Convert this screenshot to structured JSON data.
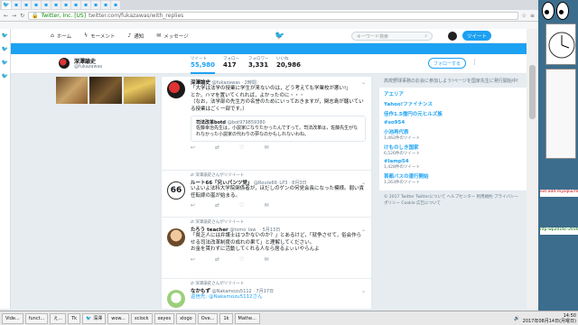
{
  "browser": {
    "tab_icon": "twitter-bird-icon",
    "url_company": "Twitter, Inc. [US]",
    "url": "twitter.com/fukazawas/with_replies"
  },
  "twitter_nav": {
    "home": "ホーム",
    "moments": "モーメント",
    "notifications": "通知",
    "messages": "メッセージ",
    "search_placeholder": "キーワード検索",
    "tweet_button": "ツイート"
  },
  "profile": {
    "name": "深澤諭史",
    "handle": "@fukazawas",
    "stats": [
      {
        "label": "ツイート",
        "value": "55,980"
      },
      {
        "label": "フォロー",
        "value": "417"
      },
      {
        "label": "フォロワー",
        "value": "3,331"
      },
      {
        "label": "いいね",
        "value": "20,986"
      }
    ],
    "follow_button": "フォローする"
  },
  "tweets": [
    {
      "retweet_line": "",
      "name": "深澤諭史",
      "handle": "@fukazawas",
      "time": "2時間",
      "text": "「大学は法学の授業に学生が来ないのは，どう考えても学業校が悪い!」\nとか，ハマを置いてくれれば，よかったのに・・・\n（なお，法学部の先生方の名誉のためにいっておきますが，関志島が聴いている授業はごく一部です。）",
      "quote": {
        "name": "司法改革botd",
        "handle": "@bot979859380",
        "text": "佐藤幸治先生は，小説家になりたかったんですって。司法改革は，佐藤先生がなれなかった小説家の代わりの夢なのかもしれないわね。"
      }
    },
    {
      "retweet_line": "深澤諭史さんがリツイート",
      "name": "ルート66「兄ぃパンツ党」",
      "handle": "@Route66_LP3",
      "time": "8月3日",
      "text": "いよいよ法科大学院関係者が，ほだしのゲンの何党会長になった模様。弱い責任転嫁の嵐が始まる。",
      "quote": null
    },
    {
      "retweet_line": "深澤諭史さんがリツイート",
      "name": "たろう teacher",
      "handle": "@tomo_law_",
      "time": "5月13日",
      "text": "「貧乏人には弁護士はつかないのか？」とあるけど，「就争させて，俗会作らせる司法改革制度の成れの果て」と理解してください。\nお金を貰わずに活動してくれる人なら居るよぃいやらんよ",
      "quote": null
    },
    {
      "retweet_line": "深澤諭史さんがリツイート",
      "name": "なかもず",
      "handle": "@Nakamozu5112",
      "time": "7月17日",
      "text": "返信先: @Nakamozu5112さん",
      "quote": null
    }
  ],
  "right_column": {
    "promo": "高校野球事務のお会に参加しよう!ページを国家先生に発行開始中!",
    "trends": [
      {
        "name": "アエリア",
        "count": ""
      },
      {
        "name": "Yahoo!ファイナンス",
        "count": ""
      },
      {
        "name": "佳作1.5億円の元ヒルズ族",
        "count": ""
      },
      {
        "name": "#so954",
        "count": ""
      },
      {
        "name": "小池再代表",
        "count": "1,462件のツイート"
      },
      {
        "name": "けものしき国家",
        "count": "6,526件のツイート"
      },
      {
        "name": "#lamp54",
        "count": "1,428件のツイート"
      },
      {
        "name": "首都バスの運行開始",
        "count": "1,263件のツイート"
      }
    ],
    "footer": "© 2017 Twitter  Twitterについて  ヘルプセンター  利用規約  プライバシーポリシー  Cookie  広告について"
  },
  "desktop": {
    "label1": "ext-add-mysqlui/mj",
    "label2": "ntp-wp2016c-201610"
  },
  "taskbar": {
    "items": [
      "Vide...",
      "funct...",
      "え...",
      "Tk",
      "深澤",
      "wow...",
      "xclock",
      "xeyes",
      "xlogo",
      "Ove...",
      "1k",
      "Mathe..."
    ],
    "time": "14:50",
    "date": "2017年08月14日(月曜日)"
  }
}
